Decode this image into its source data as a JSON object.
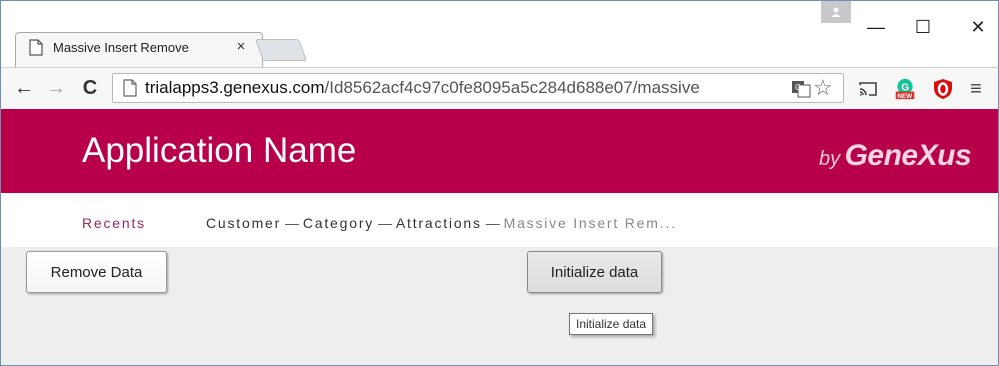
{
  "browser": {
    "tab": {
      "title": "Massive Insert Remove",
      "close_glyph": "×"
    },
    "window_controls": {
      "minimize": "—",
      "maximize": "☐",
      "close": "✕"
    },
    "nav": {
      "back": "←",
      "forward": "→",
      "reload": "C"
    },
    "address": {
      "host": "trialapps3.genexus.com",
      "path": "/Id8562acf4c97c0fe8095a5c284d688e07/massive"
    },
    "menu_glyph": "≡",
    "star_glyph": "☆",
    "grammarly_badge": "NEW"
  },
  "app": {
    "title": "Application Name",
    "brand_by": "by",
    "brand_name": "GeneXus",
    "accent_color": "#b8004a"
  },
  "breadcrumb": {
    "recents": "Recents",
    "items": [
      "Customer",
      "Category",
      "Attractions"
    ],
    "current": "Massive Insert Rem...",
    "separator": " — "
  },
  "main": {
    "remove_button": "Remove Data",
    "init_button": "Initialize data",
    "tooltip": "Initialize data"
  }
}
